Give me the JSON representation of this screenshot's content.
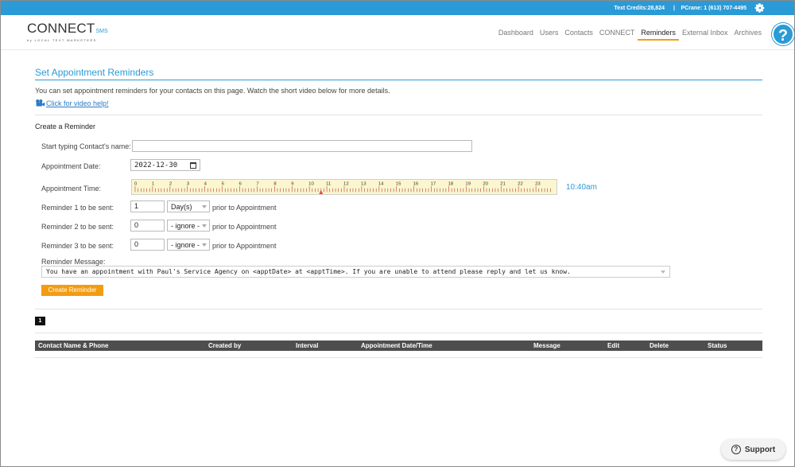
{
  "topbar": {
    "credits": "Text Credits:28,824",
    "separator": "|",
    "user": "PCrane: 1 (613) 707-4495",
    "settings_icon": "gear-icon"
  },
  "logo": {
    "brand": "CONNECT",
    "sub": "SMS",
    "tagline": "by LOCAL TEXT MARKETERS"
  },
  "nav": {
    "items": [
      "Dashboard",
      "Users",
      "Contacts",
      "CONNECT",
      "Reminders",
      "External Inbox",
      "Archives"
    ],
    "active": "Reminders",
    "help_label": "?"
  },
  "page": {
    "title": "Set Appointment Reminders",
    "intro": "You can set appointment reminders for your contacts on this page. Watch the short video below for more details.",
    "video_link": "Click for video help!",
    "create_heading": "Create a Reminder"
  },
  "form": {
    "contact_label": "Start typing Contact's name:",
    "contact_value": "",
    "date_label": "Appointment Date:",
    "date_value": "2022-12-30",
    "time_label": "Appointment Time:",
    "time_value": "10:40am",
    "time_hours": [
      "0",
      "1",
      "2",
      "3",
      "4",
      "5",
      "6",
      "7",
      "8",
      "9",
      "10",
      "11",
      "12",
      "13",
      "14",
      "15",
      "16",
      "17",
      "18",
      "19",
      "20",
      "21",
      "22",
      "23"
    ],
    "reminder1_label": "Reminder 1 to be sent:",
    "reminder1_value": "1",
    "reminder1_unit": "Day(s)",
    "reminder2_label": "Reminder 2 to be sent:",
    "reminder2_value": "0",
    "reminder2_unit": "- ignore -",
    "reminder3_label": "Reminder 3 to be sent:",
    "reminder3_value": "0",
    "reminder3_unit": "- ignore -",
    "prior_text": "prior to Appointment",
    "message_label": "Reminder Message:",
    "message_value": "You have an appointment with Paul's Service Agency on <apptDate> at <apptTime>. If you are unable to attend please reply and let us know.",
    "create_button": "Create Reminder"
  },
  "pagination": {
    "current": "1"
  },
  "table": {
    "headers": [
      "Contact Name & Phone",
      "Created by",
      "Interval",
      "Appointment Date/Time",
      "Message",
      "Edit",
      "Delete",
      "Status"
    ]
  },
  "support": {
    "label": "Support"
  },
  "colors": {
    "accent": "#2a9bd6",
    "button": "#f39c12",
    "timeline_bg": "#fbf6cf"
  }
}
